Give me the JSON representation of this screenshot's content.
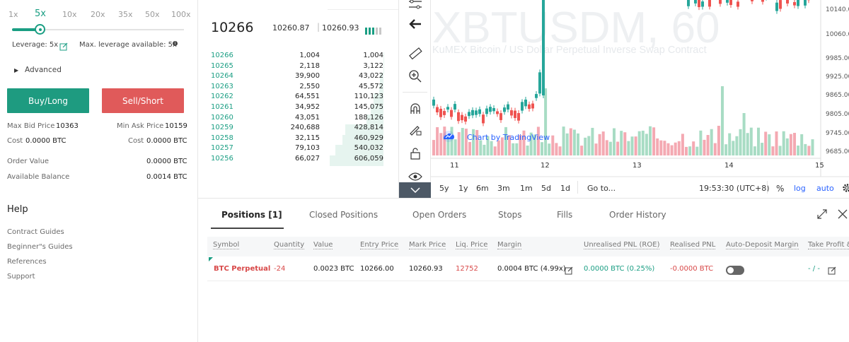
{
  "leverage": {
    "ticks": [
      "1x",
      "5x",
      "10x",
      "20x",
      "35x",
      "50x",
      "100x"
    ],
    "selected": "5x",
    "leverage_label": "Leverage: 5x",
    "max_available_label": "Max. leverage available: 5x"
  },
  "advanced_label": "Advanced",
  "buttons": {
    "buy": "Buy/Long",
    "sell": "Sell/Short"
  },
  "order_info": {
    "max_bid_label": "Max Bid Price",
    "max_bid_value": "10363",
    "min_ask_label": "Min Ask Price",
    "min_ask_value": "10159",
    "cost_label": "Cost",
    "cost_buy_value": "0.0000 BTC",
    "cost_sell_value": "0.0000 BTC",
    "order_value_label": "Order Value",
    "order_value": "0.0000 BTC",
    "available_balance_label": "Available Balance",
    "available_balance": "0.0014 BTC"
  },
  "help": {
    "title": "Help",
    "links": [
      "Contract Guides",
      "Beginner\"s Guides",
      "References",
      "Support"
    ]
  },
  "orderbook": {
    "last_price": "10266",
    "mark_price": "10260.87",
    "index_price": "10260.93",
    "rows": [
      {
        "price": "10266",
        "amount": "1,004",
        "total": "1,004",
        "depth": 0.002
      },
      {
        "price": "10265",
        "amount": "2,118",
        "total": "3,122",
        "depth": 0.005
      },
      {
        "price": "10264",
        "amount": "39,900",
        "total": "43,022",
        "depth": 0.07
      },
      {
        "price": "10263",
        "amount": "2,550",
        "total": "45,572",
        "depth": 0.075
      },
      {
        "price": "10262",
        "amount": "64,551",
        "total": "110,123",
        "depth": 0.18
      },
      {
        "price": "10261",
        "amount": "34,952",
        "total": "145,075",
        "depth": 0.24
      },
      {
        "price": "10260",
        "amount": "43,051",
        "total": "188,126",
        "depth": 0.31
      },
      {
        "price": "10259",
        "amount": "240,688",
        "total": "428,814",
        "depth": 0.71
      },
      {
        "price": "10258",
        "amount": "32,115",
        "total": "460,929",
        "depth": 0.76
      },
      {
        "price": "10257",
        "amount": "79,103",
        "total": "540,032",
        "depth": 0.89
      },
      {
        "price": "10256",
        "amount": "66,027",
        "total": "606,059",
        "depth": 1.0
      }
    ]
  },
  "chart": {
    "watermark_symbol": "XBTUSDM, 60",
    "watermark_title": "KuMEX Bitcoin / US Dollar Perpetual Inverse Swap Contract",
    "attribution": "Chart by TradingView",
    "price_axis": [
      "10140.00",
      "10060.00",
      "9985.00",
      "9925.00",
      "9865.00",
      "9805.00",
      "9745.00",
      "9685.00"
    ],
    "date_axis": [
      "11",
      "12",
      "13",
      "14",
      "15"
    ],
    "timeframes": [
      "5y",
      "1y",
      "6m",
      "3m",
      "1m",
      "5d",
      "1d"
    ],
    "goto_label": "Go to...",
    "clock": "19:53:30 (UTC+8)",
    "percent_label": "%",
    "log_label": "log",
    "auto_label": "auto",
    "colors": {
      "up": "#26a69a",
      "down": "#ef5350",
      "vol_up": "#a8dcc4",
      "vol_down": "#f4a9b2"
    }
  },
  "toolbar_icons": [
    "fork-line-icon",
    "arrow-left-icon",
    "ruler-icon",
    "zoom-in-icon",
    "magnet-icon",
    "pencil-lock-icon",
    "unlock-icon",
    "eye-icon",
    "chevron-down-icon"
  ],
  "positions": {
    "tabs": [
      "Positions [1]",
      "Closed Positions",
      "Open Orders",
      "Stops",
      "Fills",
      "Order History"
    ],
    "columns": [
      "Symbol",
      "Quantity",
      "Value",
      "Entry Price",
      "Mark Price",
      "Liq. Price",
      "Margin",
      "Unrealised PNL (ROE)",
      "Realised PNL",
      "Auto-Deposit Margin",
      "Take Profit &"
    ],
    "row": {
      "symbol": "BTC Perpetual",
      "quantity": "-24",
      "value": "0.0023 BTC",
      "entry_price": "10266.00",
      "mark_price": "10260.93",
      "liq_price": "12752",
      "margin": "0.0004 BTC (4.99x)",
      "unrealised_pnl": "0.0000 BTC (0.25%)",
      "realised_pnl": "-0.0000 BTC",
      "take_profit": "- / -"
    }
  }
}
